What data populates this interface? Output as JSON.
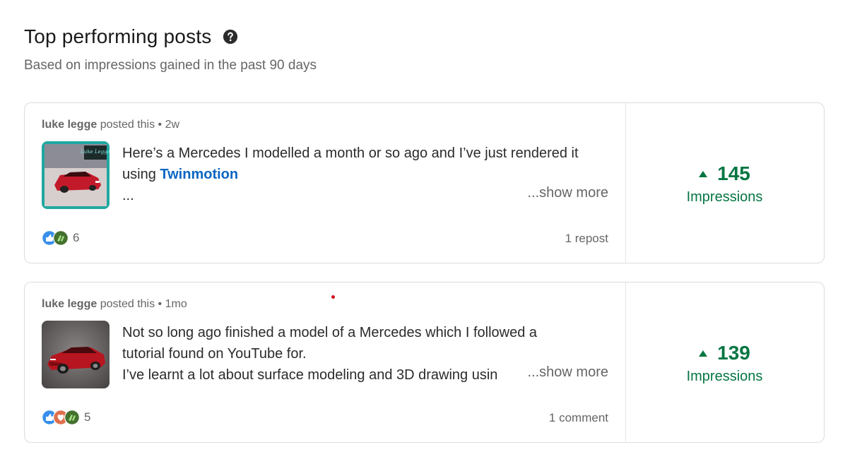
{
  "section": {
    "title": "Top performing posts",
    "subtitle": "Based on impressions gained in the past 90 days"
  },
  "posts": [
    {
      "author": "luke legge",
      "posted_text": "posted this",
      "time": "2w",
      "text_line1": "Here’s a Mercedes I modelled a month or so ago and I’ve just rendered it",
      "text_line2_prefix": "using ",
      "text_line2_link": "Twinmotion",
      "text_line3": "...",
      "show_more": "...show more",
      "reactions_count": "6",
      "secondary_stat": "1 repost",
      "impressions": "145",
      "impressions_label": "Impressions",
      "thumbnail_watermark": "Luke Legge"
    },
    {
      "author": "luke legge",
      "posted_text": "posted this",
      "time": "1mo",
      "text_line1": "Not so long ago finished a model of a Mercedes which I followed a",
      "text_line2": "tutorial found on YouTube for.",
      "text_line3": "I’ve learnt a lot about surface modeling and 3D drawing usin",
      "show_more": "...show more",
      "reactions_count": "5",
      "secondary_stat": "1 comment",
      "impressions": "139",
      "impressions_label": "Impressions"
    }
  ],
  "colors": {
    "accent_green": "#057642",
    "link_blue": "#0a66c2"
  },
  "icons": [
    "help-circle-icon",
    "like-reaction-icon",
    "celebrate-reaction-icon",
    "love-reaction-icon",
    "up-triangle-icon"
  ]
}
